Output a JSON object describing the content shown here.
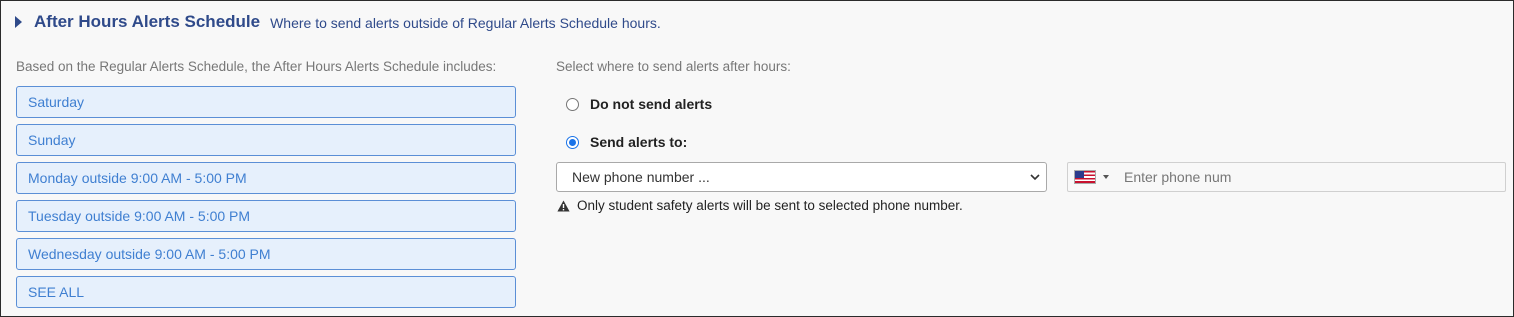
{
  "header": {
    "title": "After Hours Alerts Schedule",
    "subtitle": "Where to send alerts outside of Regular Alerts Schedule hours."
  },
  "schedule": {
    "label": "Based on the Regular Alerts Schedule, the After Hours Alerts Schedule includes:",
    "items": [
      "Saturday",
      "Sunday",
      "Monday outside 9:00 AM - 5:00 PM",
      "Tuesday outside 9:00 AM - 5:00 PM",
      "Wednesday outside 9:00 AM - 5:00 PM"
    ],
    "see_all": "SEE ALL"
  },
  "destination": {
    "label": "Select where to send alerts after hours:",
    "options": [
      {
        "label": "Do not send alerts",
        "selected": false
      },
      {
        "label": "Send alerts to:",
        "selected": true
      }
    ],
    "select_value": "New phone number ...",
    "phone_placeholder": "Enter phone num",
    "country_flag": "us-flag-icon",
    "notice": "Only student safety alerts will be sent to selected phone number."
  },
  "colors": {
    "title": "#2f4a8a",
    "item_bg": "#e6f0fc",
    "item_border": "#5b8fd6",
    "item_text": "#3f7fd1",
    "radio_selected": "#1a73e8"
  }
}
